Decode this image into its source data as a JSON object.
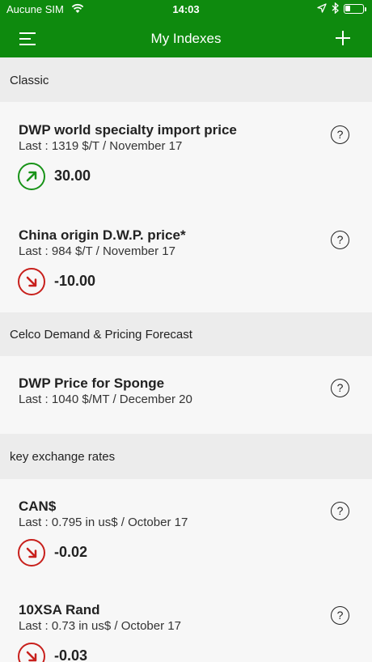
{
  "status_bar": {
    "carrier": "Aucune SIM",
    "time": "14:03",
    "icons": [
      "wifi-icon",
      "location-icon",
      "bluetooth-icon",
      "battery-icon"
    ],
    "battery_level_fraction": 0.25
  },
  "nav": {
    "title": "My Indexes",
    "menu_icon": "hamburger-menu-icon",
    "add_icon": "plus-icon"
  },
  "colors": {
    "brand_green": "#0e8a0e",
    "up_green": "#189318",
    "down_red": "#c8201c",
    "section_bg": "#ececec",
    "card_bg": "#f7f7f7"
  },
  "sections": [
    {
      "label": "Classic",
      "items": [
        {
          "name": "DWP world specialty import  price",
          "last": "Last : 1319 $/T / November 17",
          "change": "30.00",
          "direction": "up"
        },
        {
          "name": "China origin D.W.P. price*",
          "last": "Last : 984 $/T / November 17",
          "change": "-10.00",
          "direction": "down"
        }
      ]
    },
    {
      "label": "Celco Demand & Pricing Forecast",
      "items": [
        {
          "name": "DWP Price for Sponge",
          "last": "Last : 1040 $/MT / December 20"
        }
      ]
    },
    {
      "label": "key exchange rates",
      "items": [
        {
          "name": "CAN$",
          "last": "Last : 0.795 in us$ / October 17",
          "change": "-0.02",
          "direction": "down"
        },
        {
          "name": "10XSA Rand",
          "last": "Last : 0.73 in us$ / October 17",
          "change": "-0.03",
          "direction": "down"
        }
      ]
    }
  ],
  "help_label": "?"
}
